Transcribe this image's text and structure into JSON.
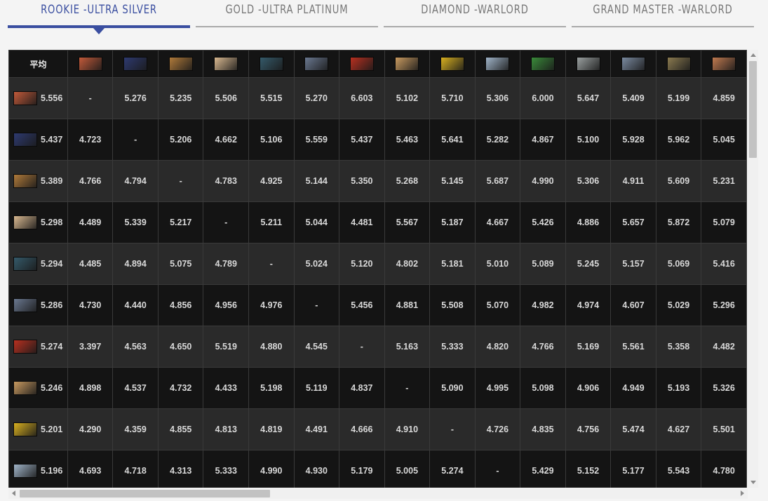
{
  "tabs": [
    {
      "label": "ROOKIE -ULTRA SILVER",
      "active": true
    },
    {
      "label": "GOLD -ULTRA PLATINUM",
      "active": false
    },
    {
      "label": "DIAMOND -WARLORD",
      "active": false
    },
    {
      "label": "GRAND MASTER -WARLORD",
      "active": false
    }
  ],
  "colors": {
    "accent": "#3a4ea0"
  },
  "table": {
    "avg_header": "平均",
    "columns": [
      {
        "icon": "character-portrait-1",
        "tone": "#c25a3a"
      },
      {
        "icon": "character-portrait-2",
        "tone": "#2e3a70"
      },
      {
        "icon": "character-portrait-3",
        "tone": "#b07a3a"
      },
      {
        "icon": "character-portrait-4",
        "tone": "#d8b890"
      },
      {
        "icon": "character-portrait-5",
        "tone": "#355a6a"
      },
      {
        "icon": "character-portrait-6",
        "tone": "#6a7890"
      },
      {
        "icon": "character-portrait-7",
        "tone": "#b83020"
      },
      {
        "icon": "character-portrait-8",
        "tone": "#c89a60"
      },
      {
        "icon": "character-portrait-9",
        "tone": "#d8b020"
      },
      {
        "icon": "character-portrait-10",
        "tone": "#a0b4c8"
      },
      {
        "icon": "character-portrait-11",
        "tone": "#3a8a3a"
      },
      {
        "icon": "character-portrait-12",
        "tone": "#9aa0a0"
      },
      {
        "icon": "character-portrait-13",
        "tone": "#7a8aa0"
      },
      {
        "icon": "character-portrait-14",
        "tone": "#8a7a50"
      },
      {
        "icon": "character-portrait-15",
        "tone": "#c07a50"
      }
    ],
    "rows": [
      {
        "icon": "character-portrait-1",
        "tone": "#c25a3a",
        "avg": "5.556",
        "values": [
          "-",
          "5.276",
          "5.235",
          "5.506",
          "5.515",
          "5.270",
          "6.603",
          "5.102",
          "5.710",
          "5.306",
          "6.000",
          "5.647",
          "5.409",
          "5.199",
          "4.859"
        ]
      },
      {
        "icon": "character-portrait-2",
        "tone": "#2e3a70",
        "avg": "5.437",
        "values": [
          "4.723",
          "-",
          "5.206",
          "4.662",
          "5.106",
          "5.559",
          "5.437",
          "5.463",
          "5.641",
          "5.282",
          "4.867",
          "5.100",
          "5.928",
          "5.962",
          "5.045"
        ]
      },
      {
        "icon": "character-portrait-3",
        "tone": "#b07a3a",
        "avg": "5.389",
        "values": [
          "4.766",
          "4.794",
          "-",
          "4.783",
          "4.925",
          "5.144",
          "5.350",
          "5.268",
          "5.145",
          "5.687",
          "4.990",
          "5.306",
          "4.911",
          "5.609",
          "5.231"
        ]
      },
      {
        "icon": "character-portrait-4",
        "tone": "#d8b890",
        "avg": "5.298",
        "values": [
          "4.489",
          "5.339",
          "5.217",
          "-",
          "5.211",
          "5.044",
          "4.481",
          "5.567",
          "5.187",
          "4.667",
          "5.426",
          "4.886",
          "5.657",
          "5.872",
          "5.079"
        ]
      },
      {
        "icon": "character-portrait-5",
        "tone": "#355a6a",
        "avg": "5.294",
        "values": [
          "4.485",
          "4.894",
          "5.075",
          "4.789",
          "-",
          "5.024",
          "5.120",
          "4.802",
          "5.181",
          "5.010",
          "5.089",
          "5.245",
          "5.157",
          "5.069",
          "5.416"
        ]
      },
      {
        "icon": "character-portrait-6",
        "tone": "#6a7890",
        "avg": "5.286",
        "values": [
          "4.730",
          "4.440",
          "4.856",
          "4.956",
          "4.976",
          "-",
          "5.456",
          "4.881",
          "5.508",
          "5.070",
          "4.982",
          "4.974",
          "4.607",
          "5.029",
          "5.296"
        ]
      },
      {
        "icon": "character-portrait-7",
        "tone": "#b83020",
        "avg": "5.274",
        "values": [
          "3.397",
          "4.563",
          "4.650",
          "5.519",
          "4.880",
          "4.545",
          "-",
          "5.163",
          "5.333",
          "4.820",
          "4.766",
          "5.169",
          "5.561",
          "5.358",
          "4.482"
        ]
      },
      {
        "icon": "character-portrait-8",
        "tone": "#c89a60",
        "avg": "5.246",
        "values": [
          "4.898",
          "4.537",
          "4.732",
          "4.433",
          "5.198",
          "5.119",
          "4.837",
          "-",
          "5.090",
          "4.995",
          "5.098",
          "4.906",
          "4.949",
          "5.193",
          "5.326"
        ]
      },
      {
        "icon": "character-portrait-9",
        "tone": "#d8b020",
        "avg": "5.201",
        "values": [
          "4.290",
          "4.359",
          "4.855",
          "4.813",
          "4.819",
          "4.491",
          "4.666",
          "4.910",
          "-",
          "4.726",
          "4.835",
          "4.756",
          "5.474",
          "4.627",
          "5.501"
        ]
      },
      {
        "icon": "character-portrait-10",
        "tone": "#a0b4c8",
        "avg": "5.196",
        "values": [
          "4.693",
          "4.718",
          "4.313",
          "5.333",
          "4.990",
          "4.930",
          "5.179",
          "5.005",
          "5.274",
          "-",
          "5.429",
          "5.152",
          "5.177",
          "5.543",
          "4.780"
        ]
      }
    ]
  }
}
